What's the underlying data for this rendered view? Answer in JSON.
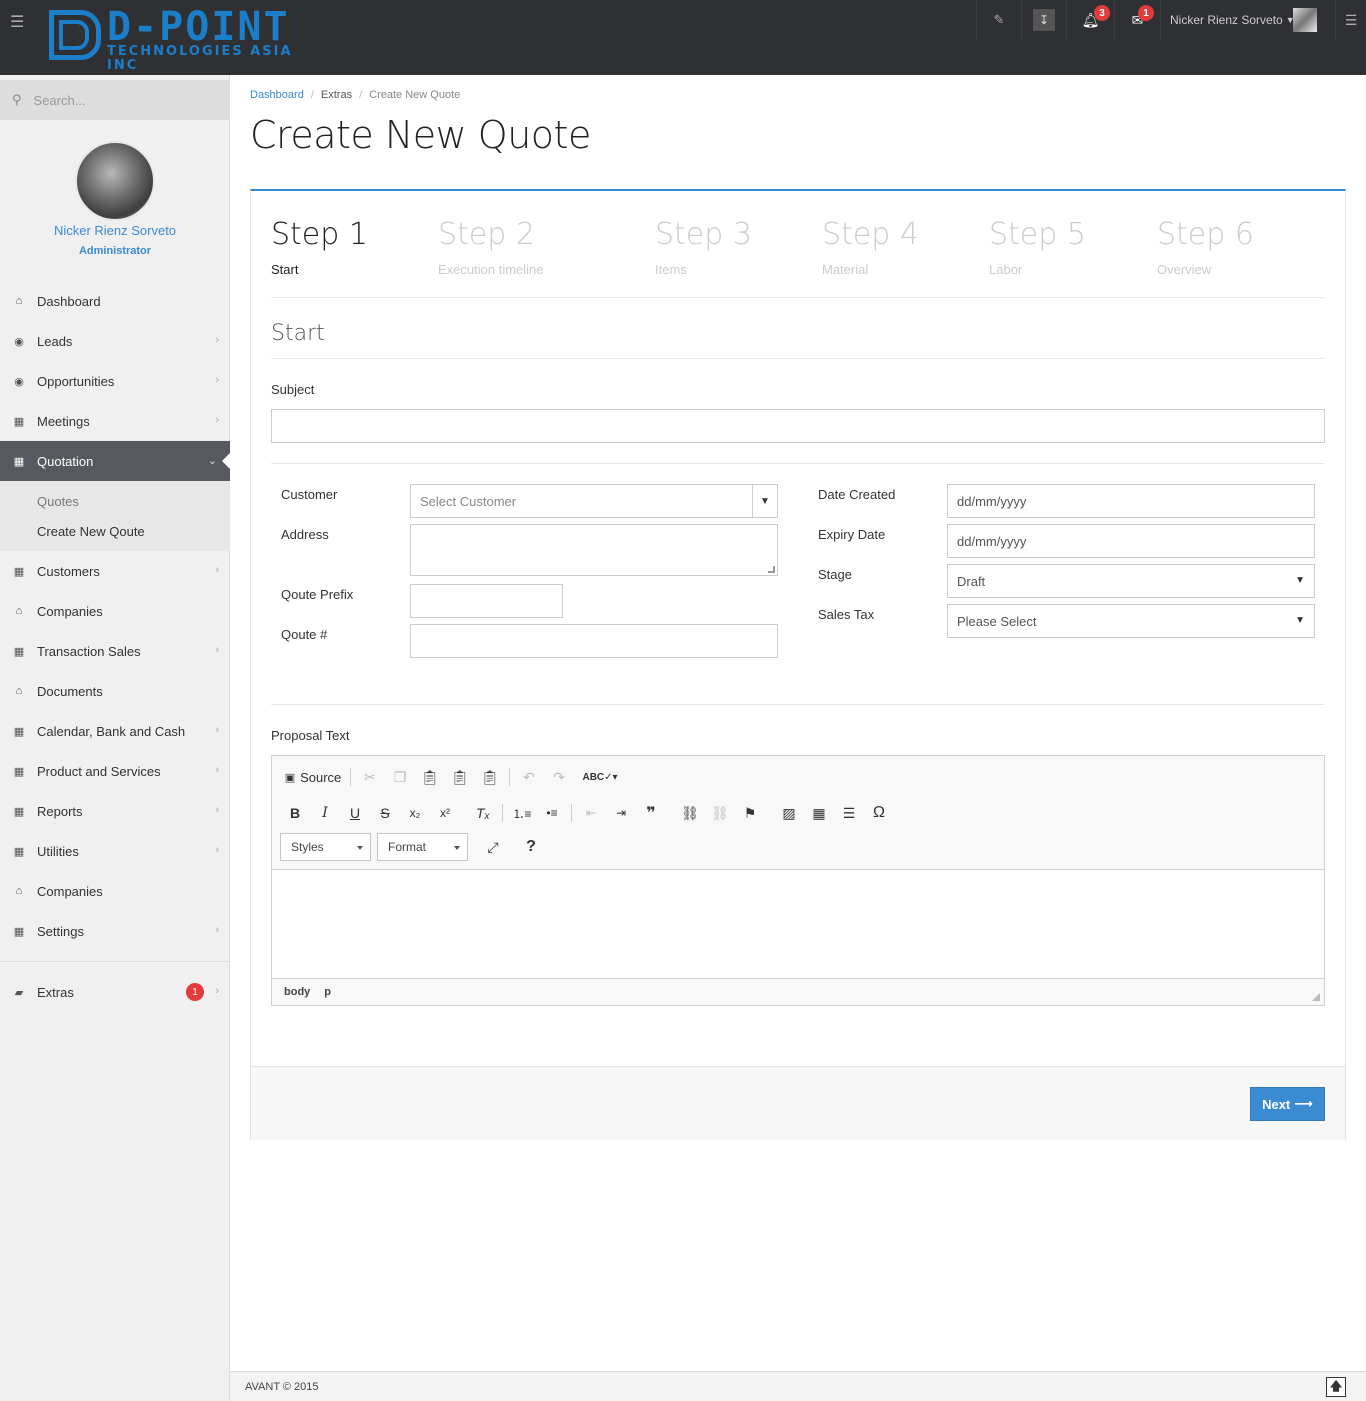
{
  "brand": {
    "name_big": "D-POINT",
    "name_small": "TECHNOLOGIES ASIA INC",
    "accent": "#1a7ec9"
  },
  "topbar": {
    "notifications_count": "3",
    "messages_count": "1",
    "user_name": "Nicker Rienz Sorveto"
  },
  "sidebar": {
    "search_placeholder": "Search...",
    "profile": {
      "name": "Nicker Rienz Sorveto",
      "role": "Administrator"
    },
    "items": [
      {
        "label": "Dashboard"
      },
      {
        "label": "Leads"
      },
      {
        "label": "Opportunities"
      },
      {
        "label": "Meetings"
      },
      {
        "label": "Quotation"
      },
      {
        "label": "Customers"
      },
      {
        "label": "Companies"
      },
      {
        "label": "Transaction Sales"
      },
      {
        "label": "Documents"
      },
      {
        "label": "Calendar, Bank and Cash"
      },
      {
        "label": "Product and Services"
      },
      {
        "label": "Reports"
      },
      {
        "label": "Utilities"
      },
      {
        "label": "Companies"
      },
      {
        "label": "Settings"
      },
      {
        "label": "Extras",
        "badge": "1"
      }
    ],
    "quotation_sub": [
      {
        "label": "Quotes"
      },
      {
        "label": "Create New Qoute"
      }
    ]
  },
  "breadcrumb": [
    "Dashboard",
    "Extras",
    "Create New Quote"
  ],
  "page_title": "Create New Quote",
  "steps": [
    {
      "num": "Step 1",
      "label": "Start"
    },
    {
      "num": "Step 2",
      "label": "Execution timeline"
    },
    {
      "num": "Step 3",
      "label": "Items"
    },
    {
      "num": "Step 4",
      "label": "Material"
    },
    {
      "num": "Step 5",
      "label": "Labor"
    },
    {
      "num": "Step 6",
      "label": "Overview"
    }
  ],
  "form": {
    "section_title": "Start",
    "subject_label": "Subject",
    "customer_label": "Customer",
    "customer_placeholder": "Select Customer",
    "address_label": "Address",
    "prefix_label": "Qoute Prefix",
    "number_label": "Qoute #",
    "date_created_label": "Date Created",
    "date_created_value": "dd/mm/yyyy",
    "expiry_label": "Expiry Date",
    "expiry_value": "dd/mm/yyyy",
    "stage_label": "Stage",
    "stage_value": "Draft",
    "tax_label": "Sales Tax",
    "tax_value": "Please Select",
    "proposal_label": "Proposal Text"
  },
  "editor": {
    "source_label": "Source",
    "styles_label": "Styles",
    "format_label": "Format",
    "path": [
      "body",
      "p"
    ]
  },
  "next_label": "Next",
  "footer_text": "AVANT © 2015"
}
